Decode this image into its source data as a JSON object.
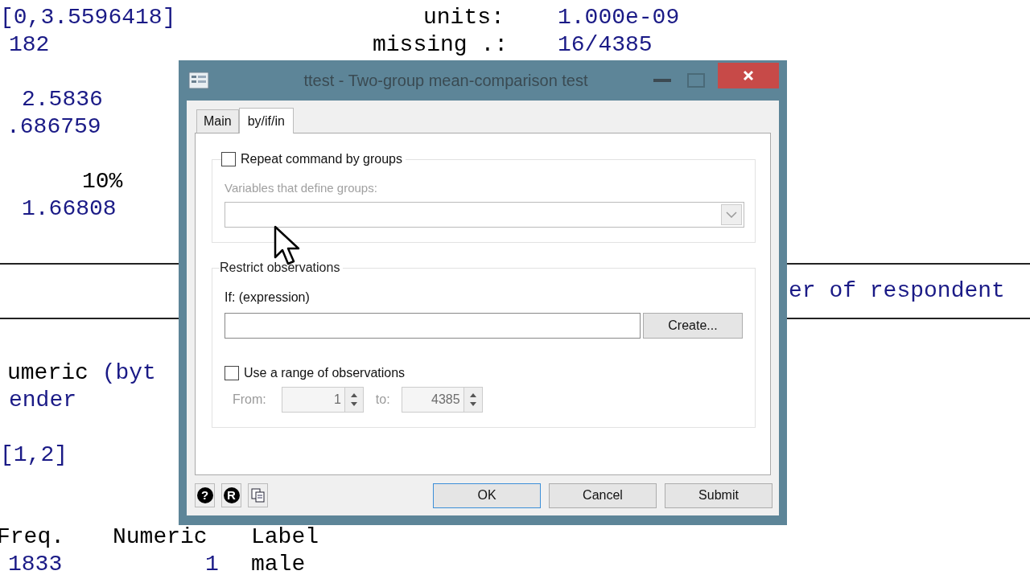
{
  "results_lines": [
    {
      "segments": [
        {
          "text": "[0,3.5596418]",
          "kind": "value"
        },
        {
          "text": "units:",
          "kind": "label"
        },
        {
          "text": "1.000e-09",
          "kind": "value"
        }
      ]
    },
    {
      "segments": [
        {
          "text": "182",
          "kind": "value"
        },
        {
          "text": "missing .:",
          "kind": "label"
        },
        {
          "text": "16/4385",
          "kind": "value"
        }
      ]
    },
    {
      "segments": [
        {
          "text": "2.5836",
          "kind": "value"
        }
      ]
    },
    {
      "segments": [
        {
          "text": ".686759",
          "kind": "value"
        }
      ]
    },
    {
      "segments": [
        {
          "text": "10%",
          "kind": "label"
        }
      ]
    },
    {
      "segments": [
        {
          "text": "1.66808",
          "kind": "value"
        }
      ]
    },
    {
      "segments": [
        {
          "text": "er of respondent",
          "kind": "value"
        }
      ]
    },
    {
      "segments": [
        {
          "text": "umeric (byt",
          "kind": "mixed"
        }
      ]
    },
    {
      "segments": [
        {
          "text": "ender",
          "kind": "value"
        }
      ]
    },
    {
      "segments": [
        {
          "text": "[1,2]",
          "kind": "value"
        }
      ]
    },
    {
      "segments": [
        {
          "text": "Freq.",
          "kind": "label"
        },
        {
          "text": "Numeric",
          "kind": "label"
        },
        {
          "text": "Label",
          "kind": "label"
        }
      ]
    },
    {
      "segments": [
        {
          "text": "1833",
          "kind": "value"
        },
        {
          "text": "1",
          "kind": "value"
        },
        {
          "text": "male",
          "kind": "label"
        }
      ]
    }
  ],
  "dialog": {
    "title": "ttest - Two-group mean-comparison test",
    "tabs": [
      {
        "label": "Main",
        "selected": false
      },
      {
        "label": "by/if/in",
        "selected": true
      }
    ],
    "by_group": {
      "checkbox": {
        "label": "Repeat command by groups",
        "checked": false
      },
      "variables_label": "Variables that define groups:",
      "disabled": true
    },
    "restrict": {
      "legend": "Restrict observations",
      "if_label": "If: (expression)",
      "create_button": "Create...",
      "range_checkbox": {
        "label": "Use a range of observations",
        "checked": false
      },
      "from_label": "From:",
      "from_value": "1",
      "to_label": "to:",
      "to_value": "4385",
      "disabled": true
    },
    "icon_buttons": [
      {
        "glyph": "?"
      },
      {
        "glyph": "R"
      }
    ],
    "buttons": [
      {
        "label": "OK",
        "default": true
      },
      {
        "label": "Cancel",
        "default": false
      },
      {
        "label": "Submit",
        "default": false
      }
    ]
  }
}
